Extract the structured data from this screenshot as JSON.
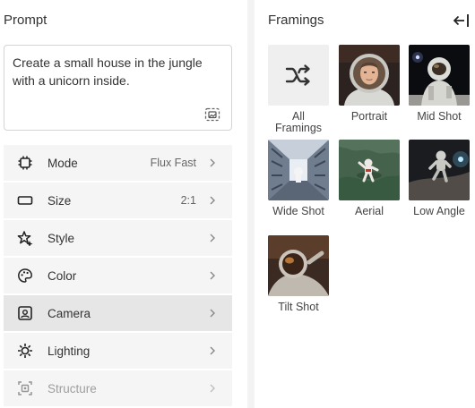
{
  "prompt": {
    "title": "Prompt",
    "text": "Create a small house in the jungle with a unicorn inside.",
    "image_button_icon": "image-add-icon"
  },
  "options": [
    {
      "label": "Mode",
      "value": "Flux Fast",
      "icon": "chip-icon"
    },
    {
      "label": "Size",
      "value": "2:1",
      "icon": "aspect-ratio-icon"
    },
    {
      "label": "Style",
      "value": "",
      "icon": "sparkle-star-icon"
    },
    {
      "label": "Color",
      "value": "",
      "icon": "palette-icon"
    },
    {
      "label": "Camera",
      "value": "",
      "icon": "camera-frame-icon",
      "active": true
    },
    {
      "label": "Lighting",
      "value": "",
      "icon": "sun-icon"
    },
    {
      "label": "Structure",
      "value": "",
      "icon": "structure-icon",
      "disabled": true
    }
  ],
  "framings": {
    "title": "Framings",
    "items": [
      {
        "label": "All\nFramings",
        "label_line1": "All",
        "label_line2": "Framings",
        "icon": "shuffle-icon"
      },
      {
        "label": "Portrait"
      },
      {
        "label": "Mid Shot"
      },
      {
        "label": "Wide Shot"
      },
      {
        "label": "Aerial"
      },
      {
        "label": "Low Angle"
      },
      {
        "label": "Tilt Shot"
      }
    ]
  }
}
